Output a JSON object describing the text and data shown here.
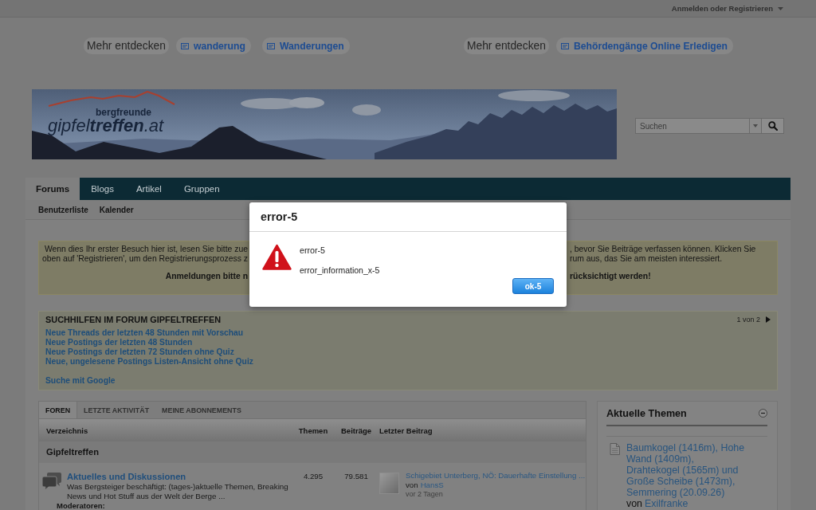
{
  "top_bar": {
    "account_link": "Anmelden oder Registrieren"
  },
  "ad_bars": [
    {
      "label": "Mehr entdecken",
      "links": [
        "wanderung",
        "Wanderungen"
      ]
    },
    {
      "label": "Mehr entdecken",
      "links": [
        "Behördengänge Online Erledigen"
      ]
    }
  ],
  "header": {
    "logo": {
      "tagline": "bergfreunde",
      "name": "gipfel**treffen**.at"
    },
    "search": {
      "placeholder": "Suchen"
    }
  },
  "nav": {
    "tabs": [
      {
        "label": "Forums",
        "selected": true
      },
      {
        "label": "Blogs",
        "selected": false
      },
      {
        "label": "Artikel",
        "selected": false
      },
      {
        "label": "Gruppen",
        "selected": false
      }
    ],
    "subnav": [
      "Benutzerliste",
      "Kalender"
    ]
  },
  "notice": {
    "lines": [
      {
        "kind": "plain",
        "left": "Wenn dies Ihr erster Besuch hier ist, lesen Sie bitte zue",
        "right": ", bevor Sie Beiträge verfassen können. Klicken Sie"
      },
      {
        "kind": "plain",
        "left": "oben auf 'Registrieren', um den Registrierungsprozess z",
        "right": "rum aus, das Sie am meisten interessiert."
      },
      {
        "kind": "strong",
        "left": "Anmeldungen bitte n",
        "right": "rücksichtigt werden!"
      }
    ]
  },
  "search_help": {
    "title": "SUCHHILFEN IM FORUM GIPFELTREFFEN",
    "pager": "1 von 2",
    "links": [
      "Neue Threads der letzten 48 Stunden mit Vorschau",
      "Neue Postings der letzten 48 Stunden",
      "Neue Postings der letzten 72 Stunden ohne Quiz",
      "Neue, ungelesene Postings Listen-Ansicht ohne Quiz"
    ],
    "extra_link": "Suche mit Google"
  },
  "forum_list": {
    "tabs": [
      {
        "label": "FOREN",
        "selected": true
      },
      {
        "label": "LETZTE AKTIVITÄT",
        "selected": false
      },
      {
        "label": "MEINE ABONNEMENTS",
        "selected": false
      }
    ],
    "columns": [
      "Verzeichnis",
      "Themen",
      "Beiträge",
      "Letzter Beitrag"
    ],
    "category": "Gipfeltreffen",
    "forums": [
      {
        "title": "Aktuelles und Diskussionen",
        "description": "Was Bergsteiger beschäftigt: (tages-)aktuelle Themen, Breaking News und Hot Stuff aus der Welt der Berge ...",
        "threads": "4.295",
        "posts": "79.581",
        "last_post": {
          "title": "Schigebiet Unterberg, NÖ: Dauerhafte Einstellung ...",
          "by": "von",
          "author": "HansS",
          "time": "vor 2 Tagen"
        },
        "moderators_label": "Moderatoren:"
      }
    ]
  },
  "sidebar": {
    "title": "Aktuelle Themen",
    "topics": [
      {
        "title": "Baumkogel (1416m), Hohe Wand (1409m), Drahtekogel (1565m) und Große Scheibe (1473m), Semmering (20.09.26)",
        "by": "von",
        "author": "Exilfranke"
      }
    ]
  },
  "dialog": {
    "title": "error-5",
    "message": "error-5",
    "detail": "error_information_x-5",
    "button": "ok-5"
  }
}
